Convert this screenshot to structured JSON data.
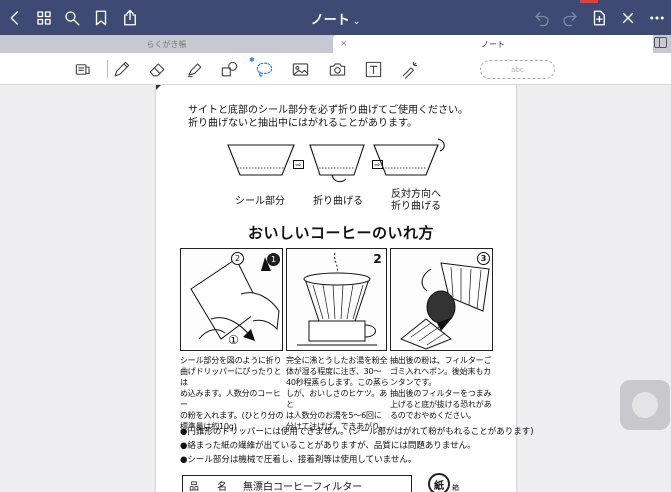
{
  "toolbar": {
    "back_icon": "chevron-left-icon",
    "grid_icon": "grid-icon",
    "search_icon": "search-icon",
    "bookmark_icon": "bookmark-icon",
    "share_icon": "share-icon",
    "title": "ノート",
    "title_chevron": "⌄",
    "undo_icon": "undo-icon",
    "redo_icon": "redo-icon",
    "add_page_icon": "add-page-icon",
    "close_icon": "close-icon",
    "more_icon": "more-icon"
  },
  "tabs": [
    {
      "label": "らくがき帳",
      "active": false
    },
    {
      "label": "ノート",
      "active": true,
      "close": "×"
    }
  ],
  "tools": [
    "scan-icon",
    "pen-icon",
    "eraser-icon",
    "highlighter-icon",
    "shapes-icon",
    "lasso-icon",
    "image-icon",
    "camera-icon",
    "text-icon",
    "laser-pointer-icon"
  ],
  "lasso_hint": "abc",
  "document": {
    "intro": [
      "サイトと底部のシール部分を必ず折り曲げてご使用ください。",
      "折り曲げないと抽出中にはがれることがあります。"
    ],
    "fold_steps": [
      "シール部分",
      "折り曲げる",
      "反対方向へ\n折り曲げる"
    ],
    "fold_arrow": "⇨",
    "heading": "おいしいコーヒーのいれ方",
    "panels": [
      {
        "nums": [
          "2",
          "1",
          "①"
        ],
        "text": [
          "シール部分を図のように折り",
          "曲げドリッパーにぴったりとは",
          "め込みます。人数分のコーヒー",
          "の粉を入れます。(ひとり分の",
          "標準量は約10g)"
        ]
      },
      {
        "nums": [
          "2"
        ],
        "text": [
          "完全に沸とうしたお湯を粉全",
          "体が湿る程度に注ぎ、30〜",
          "40秒程蒸らします。この蒸ら",
          "しが、おいしさのヒケツ。あと",
          "は人数分のお湯を5〜6回に",
          "分けて注げば、できあがり。"
        ]
      },
      {
        "nums": [
          "3"
        ],
        "text": [
          "抽出後の粉は、フィルターご",
          "ゴミ入れへポン。後始末もカ",
          "ンタンです。",
          "抽出後のフィルターをつまみ",
          "上げると底が抜ける恐れがあ",
          "るのでおやめください。"
        ]
      }
    ],
    "notes": [
      "●円錐形のドリッパーには使用できません。(シール部がはがれて粉がもれることがあります)",
      "●絡まった紙の繊維が出ていることがありますが、品質には問題ありません。",
      "●シール部分は機械で圧着し、接着剤等は使用していません。"
    ],
    "product_key": "品　名",
    "product_value": "無漂白コーヒーフィルター",
    "recycle_mark": "紙",
    "recycle_side": "箱"
  },
  "colors": {
    "topbar": "#3f4a74",
    "accent": "#2a7ad5",
    "tabbar": "#c6c9d2"
  }
}
